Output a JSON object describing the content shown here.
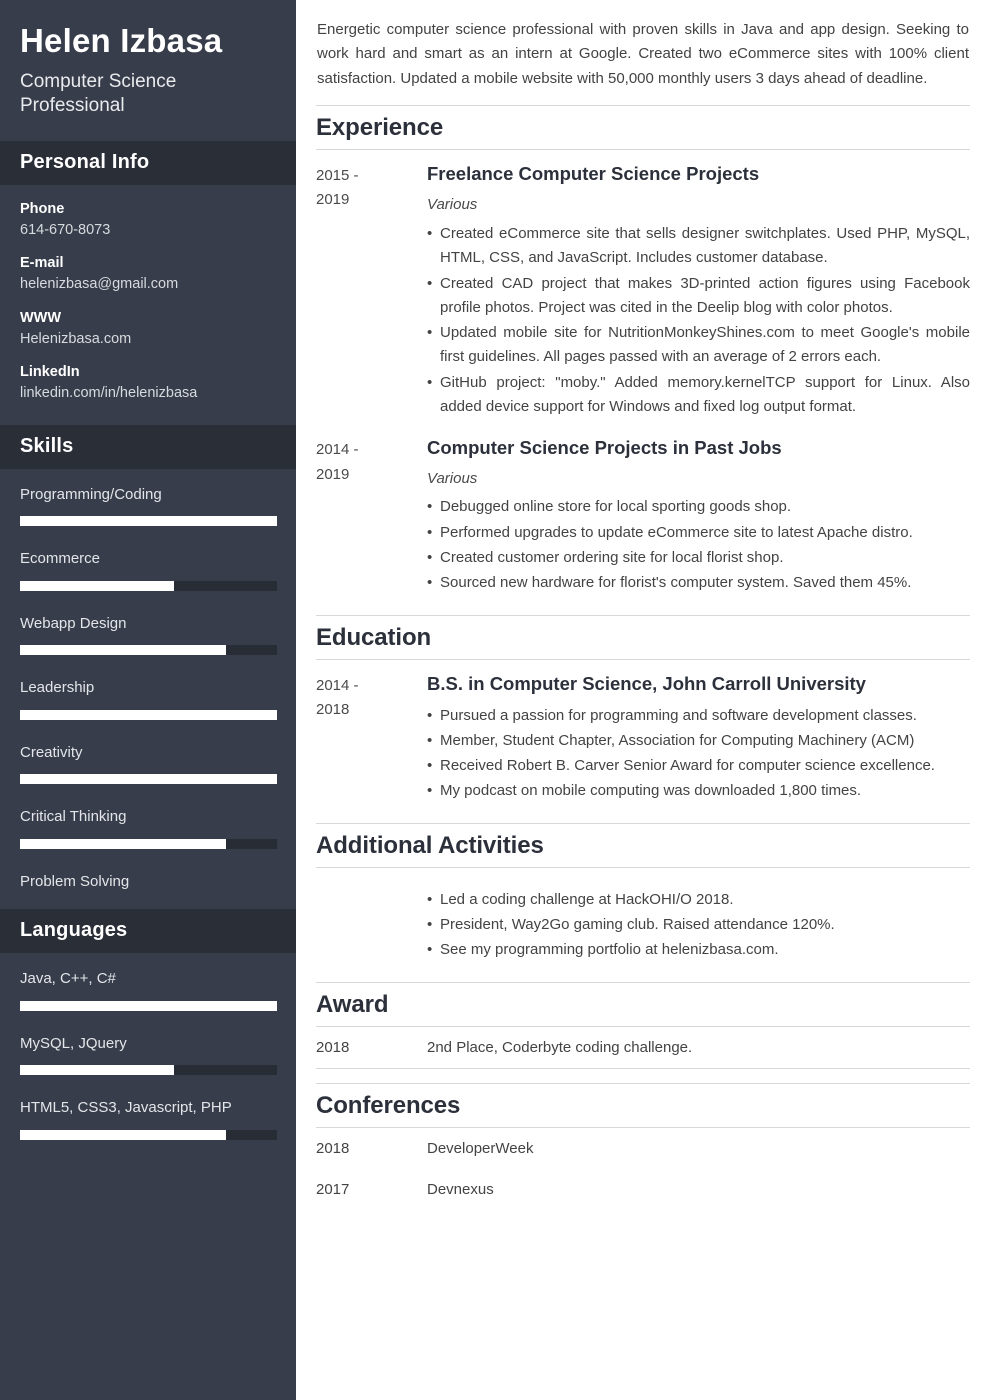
{
  "colors": {
    "sidebar_bg": "#373d4a",
    "sidebar_band_bg": "#2a2e37",
    "bar_track": "#282c35",
    "bar_fill": "#ffffff",
    "heading": "#2b303b",
    "rule": "#d8d8d8"
  },
  "sidebar": {
    "name": "Helen Izbasa",
    "role": "Computer Science Professional",
    "personal_info": {
      "title": "Personal Info",
      "items": [
        {
          "label": "Phone",
          "value": "614-670-8073"
        },
        {
          "label": "E-mail",
          "value": "helenizbasa@gmail.com"
        },
        {
          "label": "WWW",
          "value": "Helenizbasa.com"
        },
        {
          "label": "LinkedIn",
          "value": "linkedin.com/in/helenizbasa"
        }
      ]
    },
    "skills": {
      "title": "Skills",
      "items": [
        {
          "label": "Programming/Coding",
          "level": 100
        },
        {
          "label": "Ecommerce",
          "level": 60
        },
        {
          "label": "Webapp Design",
          "level": 80
        },
        {
          "label": "Leadership",
          "level": 100
        },
        {
          "label": "Creativity",
          "level": 100
        },
        {
          "label": "Critical Thinking",
          "level": 80
        },
        {
          "label": "Problem Solving",
          "level": null
        }
      ]
    },
    "languages": {
      "title": "Languages",
      "items": [
        {
          "label": "Java, C++, C#",
          "level": 100
        },
        {
          "label": "MySQL, JQuery",
          "level": 60
        },
        {
          "label": "HTML5, CSS3, Javascript, PHP",
          "level": 80
        }
      ]
    }
  },
  "main": {
    "summary": "Energetic computer science professional with proven skills in Java and app design. Seeking to work hard and smart as an intern at Google. Created two eCommerce sites with 100% client satisfaction. Updated a mobile website with 50,000 monthly users 3 days ahead of deadline.",
    "experience": {
      "title": "Experience",
      "entries": [
        {
          "date_from": "2015 -",
          "date_to": "2019",
          "title": "Freelance Computer Science Projects",
          "subtitle": "Various",
          "bullets": [
            "Created eCommerce site that sells designer switchplates. Used PHP, MySQL, HTML, CSS, and JavaScript. Includes customer database.",
            "Created CAD project that makes 3D-printed action figures using Facebook profile photos. Project was cited in the Deelip blog with color photos.",
            "Updated mobile site for NutritionMonkeyShines.com to meet Google's mobile first guidelines. All pages passed with an average of 2 errors each.",
            "GitHub project: \"moby.\" Added memory.kernelTCP support for Linux. Also added device support for Windows and fixed log output format."
          ]
        },
        {
          "date_from": "2014 -",
          "date_to": "2019",
          "title": "Computer Science Projects in Past Jobs",
          "subtitle": "Various",
          "bullets": [
            "Debugged online store for local sporting goods shop.",
            "Performed upgrades to update eCommerce site to latest Apache distro.",
            "Created customer ordering site for local florist shop.",
            "Sourced new hardware for florist's computer system. Saved them 45%."
          ]
        }
      ]
    },
    "education": {
      "title": "Education",
      "entries": [
        {
          "date_from": "2014 -",
          "date_to": "2018",
          "title": "B.S. in Computer Science, John Carroll University",
          "bullets": [
            "Pursued a passion for programming and software development classes.",
            "Member, Student Chapter, Association for Computing Machinery (ACM)",
            "Received Robert B. Carver Senior Award for computer science excellence.",
            "My podcast on mobile computing was downloaded 1,800 times."
          ]
        }
      ]
    },
    "additional_activities": {
      "title": "Additional Activities",
      "bullets": [
        "Led a coding challenge at HackOHI/O 2018.",
        "President, Way2Go gaming club. Raised attendance 120%.",
        "See my programming portfolio at helenizbasa.com."
      ]
    },
    "award": {
      "title": "Award",
      "rows": [
        {
          "date": "2018",
          "text": "2nd Place, Coderbyte coding challenge."
        }
      ]
    },
    "conferences": {
      "title": "Conferences",
      "rows": [
        {
          "date": "2018",
          "text": "DeveloperWeek"
        },
        {
          "date": "2017",
          "text": "Devnexus"
        }
      ]
    }
  }
}
